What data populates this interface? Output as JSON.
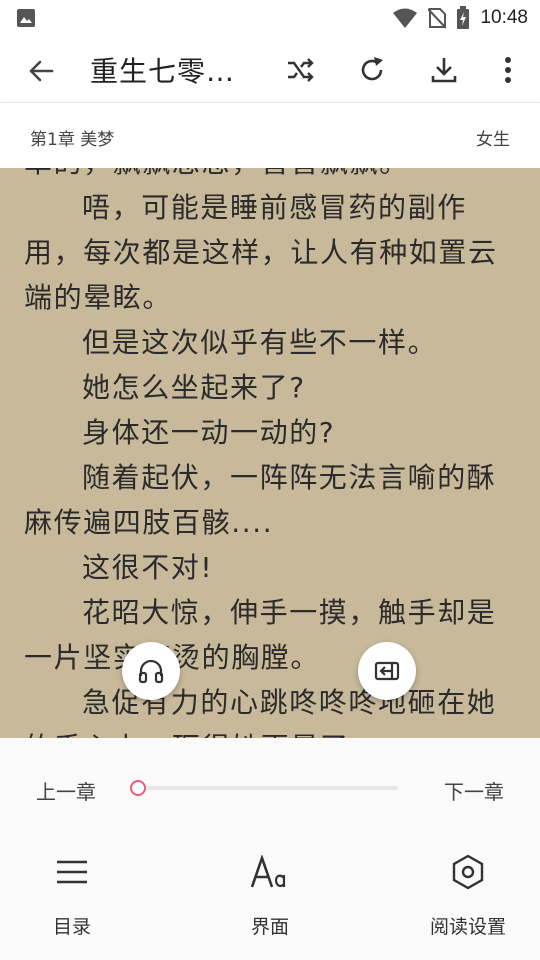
{
  "status_bar": {
    "time": "10:48"
  },
  "appbar": {
    "title": "重生七零…"
  },
  "chapter": {
    "name": "第1章 美梦",
    "category": "女生"
  },
  "reader": {
    "lines": [
      {
        "text": "草的，飘飘忽忽，喜喜飘飘。",
        "indent": false
      },
      {
        "text": "唔，可能是睡前感冒药的副作",
        "indent": true
      },
      {
        "text": "用，每次都是这样，让人有种如置云",
        "indent": false
      },
      {
        "text": "端的晕眩。",
        "indent": false
      },
      {
        "text": "但是这次似乎有些不一样。",
        "indent": true
      },
      {
        "text": "她怎么坐起来了?",
        "indent": true
      },
      {
        "text": "身体还一动一动的?",
        "indent": true
      },
      {
        "text": "随着起伏，一阵阵无法言喻的酥",
        "indent": true
      },
      {
        "text": "麻传遍四肢百骸....",
        "indent": false
      },
      {
        "text": "这很不对!",
        "indent": true
      },
      {
        "text": "花昭大惊，伸手一摸，触手却是",
        "indent": true
      },
      {
        "text": "一片坚实滚烫的胸膛。",
        "indent": false
      },
      {
        "text": "急促有力的心跳咚咚咚地砸在她",
        "indent": true
      },
      {
        "text": "的手心上，砸得她更晕了。",
        "indent": false
      }
    ]
  },
  "controls": {
    "prev_label": "上一章",
    "next_label": "下一章",
    "progress": 0.0
  },
  "toolbar": {
    "catalog_label": "目录",
    "theme_label": "界面",
    "settings_label": "阅读设置"
  },
  "colors": {
    "accent": "#f0577a",
    "paper": "#c8b99a"
  }
}
